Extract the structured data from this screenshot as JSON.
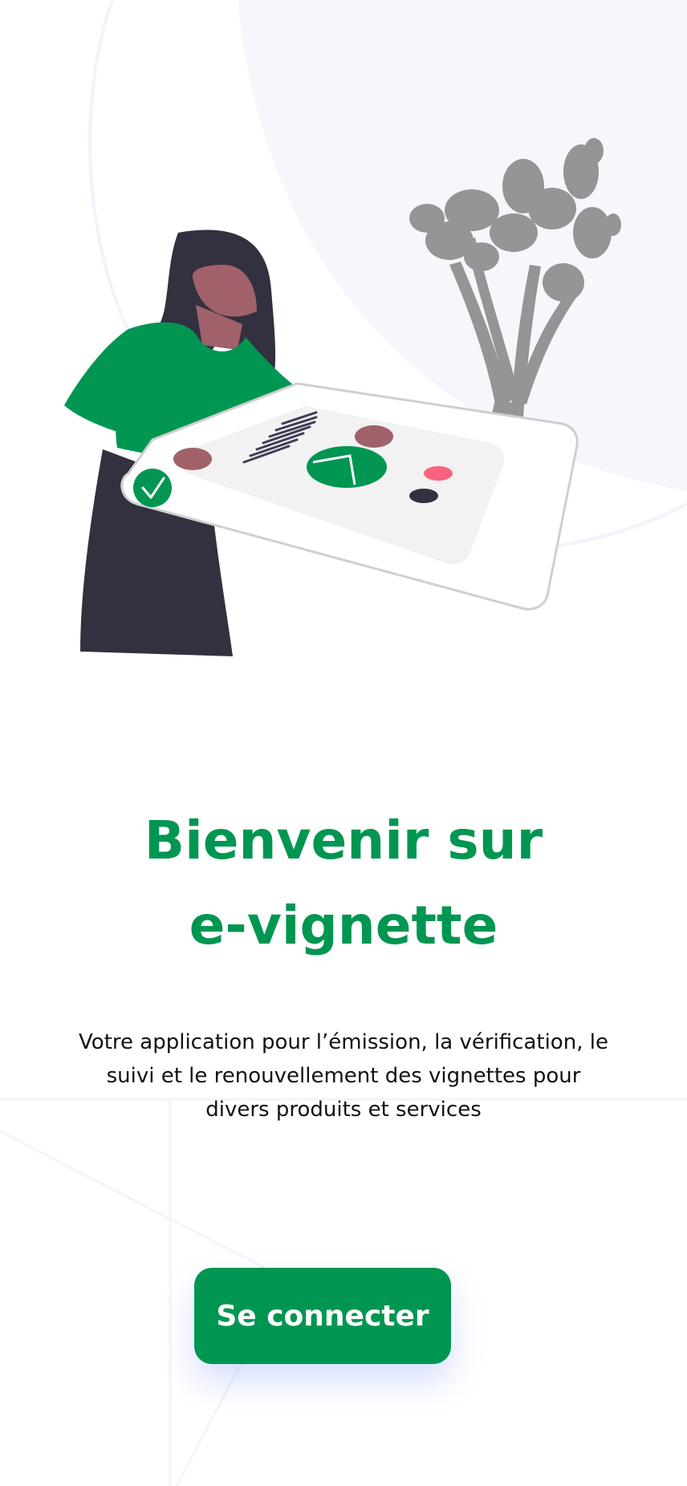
{
  "welcome": {
    "title_line1": "Bienvenir sur",
    "title_line2": "e-vignette",
    "subtitle": "Votre application pour l’émission, la vérification, le suivi et le renouvellement des vignettes pour divers produits et services",
    "login_button": "Se connecter"
  },
  "icons": {
    "illustration": "woman-presenting-dashboard-illustration",
    "plant": "plant-icon",
    "check": "check-icon",
    "pie_chart": "pie-chart-icon"
  },
  "colors": {
    "accent": "#009652",
    "background_shape": "#F7F8FD",
    "text": "#111111",
    "button_text": "#FFFFFF"
  }
}
